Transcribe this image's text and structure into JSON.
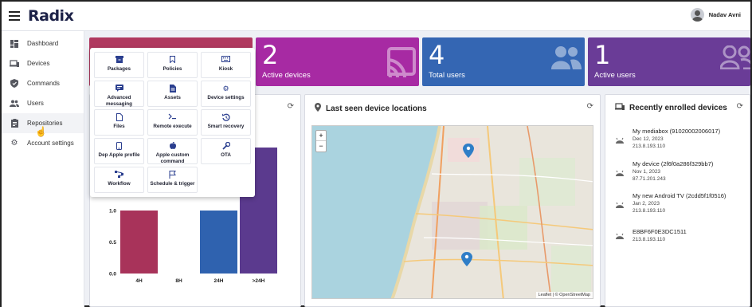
{
  "app": {
    "logo": "Radix",
    "user_name": "Nadav Avni"
  },
  "sidebar": {
    "items": [
      {
        "label": "Dashboard",
        "icon": "dashboard-icon"
      },
      {
        "label": "Devices",
        "icon": "devices-icon"
      },
      {
        "label": "Commands",
        "icon": "shield-icon"
      },
      {
        "label": "Users",
        "icon": "users-icon"
      },
      {
        "label": "Repositories",
        "icon": "clipboard-icon"
      },
      {
        "label": "Account settings",
        "icon": "gear-icon"
      }
    ],
    "active": "Repositories"
  },
  "stats": [
    {
      "value": "2",
      "label": "Active devices",
      "color": "#a72aa3",
      "icon": "cast-icon"
    },
    {
      "value": "4",
      "label": "Total users",
      "color": "#3466b3",
      "icon": "users-icon"
    },
    {
      "value": "1",
      "label": "Active users",
      "color": "#6a3c97",
      "icon": "users-icon"
    }
  ],
  "stat_first_color": "#b0395f",
  "map_card": {
    "title": "Last seen device locations",
    "zoom_in": "+",
    "zoom_out": "−",
    "attribution": "Leaflet | © OpenStreetMap"
  },
  "devices_card": {
    "title": "Recently enrolled devices",
    "devices": [
      {
        "name": "My mediabox (91020002006017)",
        "date": "Dec 12, 2023",
        "ip": "213.8.193.110"
      },
      {
        "name": "My device (2f6f0a286f329bb7)",
        "date": "Nov 1, 2023",
        "ip": "87.71.201.243"
      },
      {
        "name": "My new Android TV (2cdd5f1f0516)",
        "date": "Jan 2, 2023",
        "ip": "213.8.193.110"
      },
      {
        "name": "E8BF6F0E3DC1511",
        "date": "",
        "ip": "213.8.193.110"
      }
    ]
  },
  "repositories_menu": [
    {
      "label": "Packages",
      "icon": "archive-icon"
    },
    {
      "label": "Policies",
      "icon": "bookmark-icon"
    },
    {
      "label": "Kiosk",
      "icon": "keyboard-icon"
    },
    {
      "label": "Advanced messaging",
      "icon": "message-icon"
    },
    {
      "label": "Assets",
      "icon": "document-icon"
    },
    {
      "label": "Device settings",
      "icon": "gear-icon"
    },
    {
      "label": "Files",
      "icon": "file-icon"
    },
    {
      "label": "Remote execute",
      "icon": "terminal-icon"
    },
    {
      "label": "Smart recovery",
      "icon": "restore-icon"
    },
    {
      "label": "Dep Apple profile",
      "icon": "phone-icon"
    },
    {
      "label": "Apple custom command",
      "icon": "apple-icon"
    },
    {
      "label": "OTA",
      "icon": "wrench-icon"
    },
    {
      "label": "Workflow",
      "icon": "workflow-icon"
    },
    {
      "label": "Schedule & trigger",
      "icon": "flag-icon"
    }
  ],
  "chart_data": {
    "type": "bar",
    "categories": [
      "4H",
      "8H",
      "24H",
      ">24H"
    ],
    "values": [
      1,
      0,
      1,
      2
    ],
    "colors": [
      "#a8335a",
      "#ffffff",
      "#2f62af",
      "#5b3a8e"
    ],
    "yticks": [
      "0.0",
      "0.5",
      "1.0"
    ],
    "ylim": [
      0,
      2
    ],
    "title": "",
    "xlabel": "",
    "ylabel": ""
  }
}
